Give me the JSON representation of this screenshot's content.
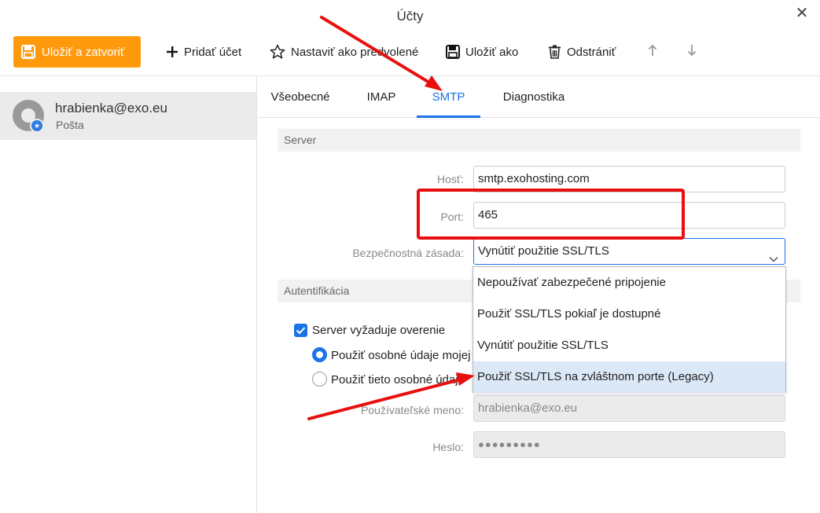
{
  "window": {
    "title": "Účty"
  },
  "toolbar": {
    "save_close": "Uložiť a zatvoriť",
    "add_account": "Pridať účet",
    "set_default": "Nastaviť ako predvolené",
    "save_as": "Uložiť ako",
    "delete": "Odstrániť"
  },
  "sidebar": {
    "account": {
      "email": "hrabienka@exo.eu",
      "type": "Pošta"
    }
  },
  "tabs": [
    {
      "label": "Všeobecné"
    },
    {
      "label": "IMAP"
    },
    {
      "label": "SMTP"
    },
    {
      "label": "Diagnostika"
    }
  ],
  "active_tab": "SMTP",
  "server": {
    "section_title": "Server",
    "host_label": "Hosť:",
    "host_value": "smtp.exohosting.com",
    "port_label": "Port:",
    "port_value": "465",
    "security_label": "Bezpečnostná zásada:",
    "security_value": "Vynútiť použitie SSL/TLS",
    "security_options": [
      "Nepoužívať zabezpečené pripojenie",
      "Použiť SSL/TLS pokiaľ je dostupné",
      "Vynútiť použitie SSL/TLS",
      "Použiť SSL/TLS na zvláštnom porte (Legacy)"
    ],
    "highlighted_option": "Použiť SSL/TLS na zvláštnom porte (Legacy)"
  },
  "auth": {
    "section_title": "Autentifikácia",
    "requires_auth_label": "Server vyžaduje overenie",
    "requires_auth_checked": true,
    "radio_use_same": "Použiť osobné údaje mojej",
    "radio_use_these": "Použiť tieto osobné údaje",
    "username_label": "Používateľské meno:",
    "username_value": "hrabienka@exo.eu",
    "password_label": "Heslo:",
    "password_value": "●●●●●●●●●"
  },
  "colors": {
    "accent": "#1a73e8",
    "primary_button": "#ff9a0d",
    "annotation": "#e8100f"
  }
}
